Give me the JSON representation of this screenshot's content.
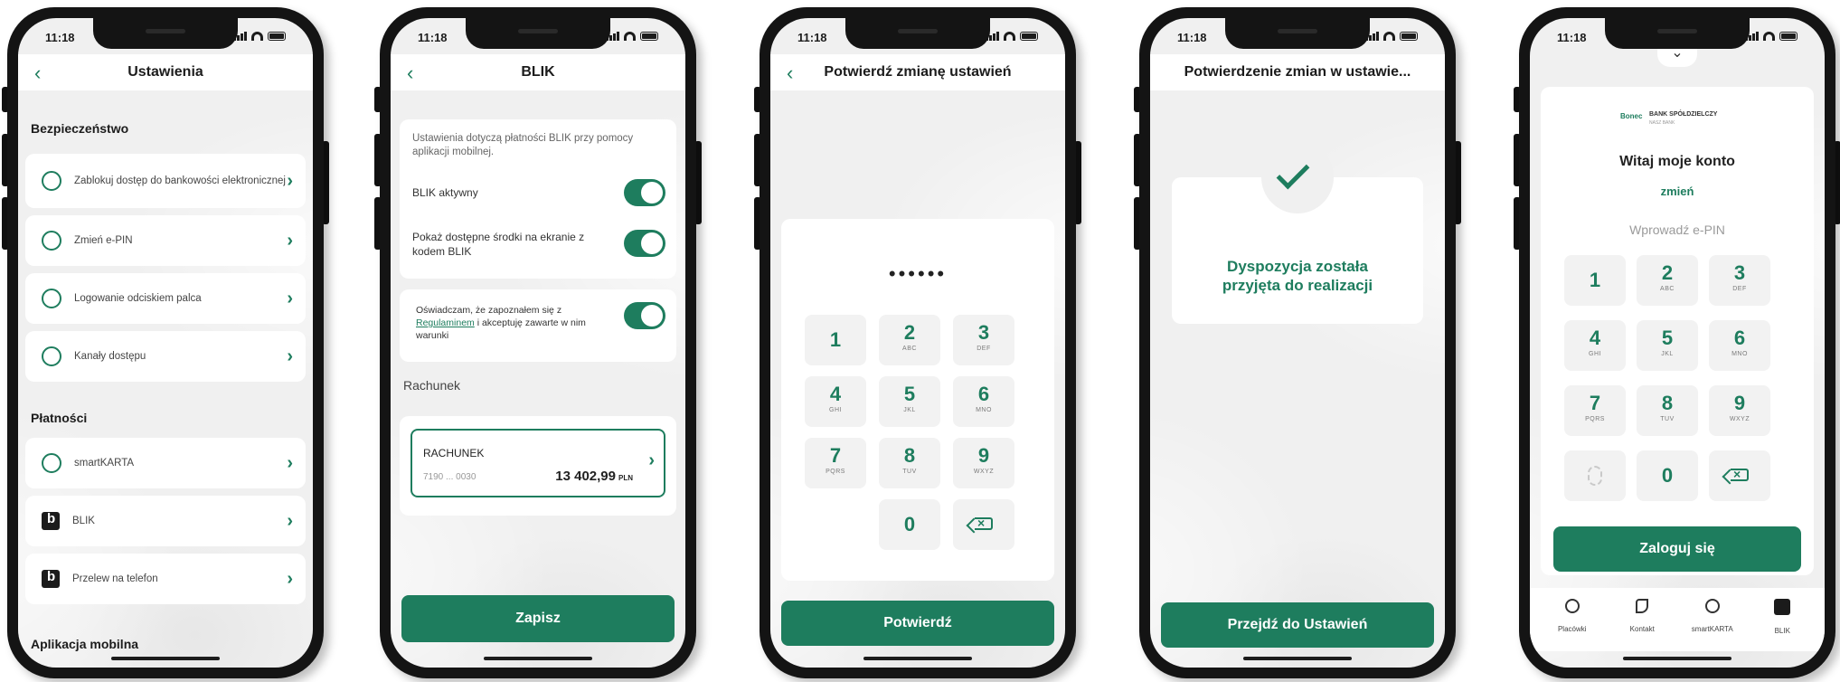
{
  "status": {
    "time": "11:18"
  },
  "screen1": {
    "title": "Ustawienia",
    "sections": {
      "security": "Bezpieczeństwo",
      "payments": "Płatności",
      "mobile": "Aplikacja mobilna"
    },
    "items": [
      {
        "label": "Zablokuj dostęp do bankowości elektronicznej",
        "icon": "block-icon"
      },
      {
        "label": "Zmień e-PIN",
        "icon": "shield-check-icon"
      },
      {
        "label": "Logowanie odciskiem palca",
        "icon": "fingerprint-icon"
      },
      {
        "label": "Kanały dostępu",
        "icon": "gear-icon"
      },
      {
        "label": "smartKARTA",
        "icon": "smartkarta-icon"
      },
      {
        "label": "BLIK",
        "icon": "blik-icon"
      },
      {
        "label": "Przelew na telefon",
        "icon": "blik-icon"
      }
    ]
  },
  "screen2": {
    "title": "BLIK",
    "info": "Ustawienia dotyczą płatności BLIK przy pomocy aplikacji mobilnej.",
    "toggle1": "BLIK aktywny",
    "toggle2": "Pokaż dostępne środki na ekranie z kodem BLIK",
    "consent_pre": "Oświadczam, że zapoznałem się z ",
    "consent_link": "Regulaminem",
    "consent_post": " i akceptuję zawarte w nim warunki",
    "account_section": "Rachunek",
    "account_name": "RACHUNEK",
    "account_number": "7190 ... 0030",
    "account_balance": "13 402,99",
    "account_currency": "PLN",
    "save": "Zapisz"
  },
  "screen3": {
    "title": "Potwierdź zmianę ustawień",
    "pin_mask": "••••••",
    "confirm": "Potwierdź"
  },
  "screen4": {
    "title": "Potwierdzenie zmian w ustawie...",
    "message": "Dyspozycja została przyjęta do realizacji",
    "button": "Przejdź do Ustawień"
  },
  "screen5": {
    "bank_name": "BANK SPÓŁDZIELCZY",
    "bank_sub": "NASZ BANK",
    "bank_mark": "Bonec",
    "greeting": "Witaj moje konto",
    "change": "zmień",
    "pin_placeholder": "Wprowadź e-PIN",
    "login": "Zaloguj się",
    "nav": [
      "Placówki",
      "Kontakt",
      "smartKARTA",
      "BLIK"
    ]
  },
  "keypad": [
    {
      "d": "1",
      "s": ""
    },
    {
      "d": "2",
      "s": "ABC"
    },
    {
      "d": "3",
      "s": "DEF"
    },
    {
      "d": "4",
      "s": "GHI"
    },
    {
      "d": "5",
      "s": "JKL"
    },
    {
      "d": "6",
      "s": "MNO"
    },
    {
      "d": "7",
      "s": "PQRS"
    },
    {
      "d": "8",
      "s": "TUV"
    },
    {
      "d": "9",
      "s": "WXYZ"
    },
    {
      "d": "0",
      "s": ""
    }
  ],
  "colors": {
    "accent": "#1e7d5e",
    "frame": "#141414",
    "screen_bg": "#f0f0f0"
  }
}
